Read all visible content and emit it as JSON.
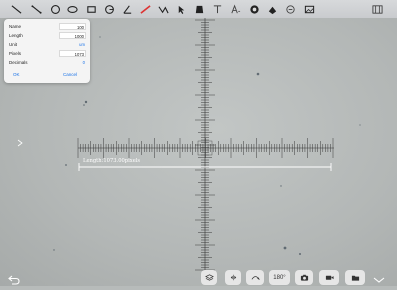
{
  "toolbar": {
    "tools": [
      "line-icon",
      "line-endpoints-icon",
      "circle-icon",
      "ellipse-icon",
      "rectangle-icon",
      "arc-icon",
      "angle-icon",
      "ruler-icon",
      "polyline-icon",
      "arrow-icon",
      "fill-icon",
      "text-icon",
      "text-format-icon",
      "color-picker-icon",
      "color-fill-icon",
      "eraser-icon",
      "image-icon"
    ],
    "right_icon": "grid-icon"
  },
  "panel": {
    "rows": [
      {
        "label": "Name",
        "value": "100"
      },
      {
        "label": "Length",
        "value": "1000"
      },
      {
        "label": "Unit",
        "value": "um"
      },
      {
        "label": "Pixels",
        "value": "1073"
      },
      {
        "label": "Decimals",
        "value": "0"
      }
    ],
    "ok_label": "OK",
    "cancel_label": "Cancel"
  },
  "measurement": {
    "label": "Length:1073.00pixels"
  },
  "bottom": {
    "undo": "undo-icon",
    "rotate_label": "180°",
    "buttons": [
      "layers-icon",
      "flip-horizontal-icon",
      "flip-vertical-icon",
      "rotate-180-button",
      "camera-icon",
      "video-icon",
      "folder-icon",
      "collapse-chevron-icon"
    ]
  },
  "colors": {
    "accent": "#1a73e8",
    "measure_line": "#ffffff"
  }
}
